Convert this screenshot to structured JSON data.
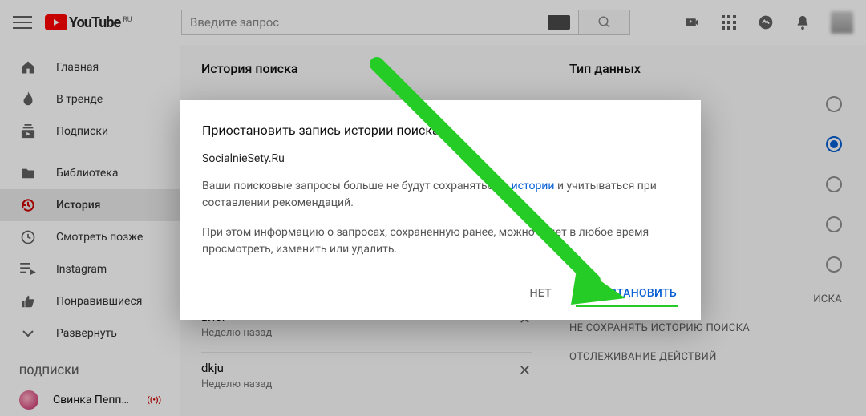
{
  "header": {
    "logo_text": "YouTube",
    "logo_region": "RU",
    "search_placeholder": "Введите запрос"
  },
  "sidebar": {
    "items": [
      {
        "label": "Главная",
        "icon": "home-icon"
      },
      {
        "label": "В тренде",
        "icon": "trending-icon"
      },
      {
        "label": "Подписки",
        "icon": "subscriptions-icon"
      },
      {
        "label": "Библиотека",
        "icon": "library-icon"
      },
      {
        "label": "История",
        "icon": "history-icon",
        "active": true
      },
      {
        "label": "Смотреть позже",
        "icon": "watch-later-icon"
      },
      {
        "label": "Instagram",
        "icon": "playlist-icon"
      },
      {
        "label": "Понравившиеся",
        "icon": "like-icon"
      },
      {
        "label": "Развернуть",
        "icon": "expand-icon"
      }
    ],
    "subs_title": "ПОДПИСКИ",
    "channels": [
      {
        "name": "Свинка Пеппа...",
        "live_badge": "((•))"
      }
    ]
  },
  "history": {
    "title": "История поиска",
    "items": [
      {
        "query": "",
        "time": ""
      },
      {
        "query": "влог",
        "time": "Неделю назад"
      },
      {
        "query": "dkju",
        "time": "Неделю назад"
      }
    ]
  },
  "type_panel": {
    "title": "Тип данных",
    "options": [
      {
        "label": "",
        "selected": false
      },
      {
        "label": "",
        "selected": true
      },
      {
        "label": "",
        "selected": false
      },
      {
        "label": "",
        "selected": false
      },
      {
        "label": "",
        "selected": false
      }
    ],
    "links": [
      "ИСКА",
      "НЕ СОХРАНЯТЬ ИСТОРИЮ ПОИСКА",
      "ОТСЛЕЖИВАНИЕ ДЕЙСТВИЙ"
    ]
  },
  "dialog": {
    "title": "Приостановить запись истории поиска?",
    "subtitle": "SocialnieSety.Ru",
    "para1_a": "Ваши поисковые запросы больше не будут сохраняться в ",
    "para1_link": "истории",
    "para1_b": " и учитываться при составлении рекомендаций.",
    "para2": "При этом информацию о запросах, сохраненную ранее, можно будет в любое время просмотреть, изменить или удалить.",
    "btn_no": "НЕТ",
    "btn_yes": "ПРИОСТАНОВИТЬ"
  }
}
